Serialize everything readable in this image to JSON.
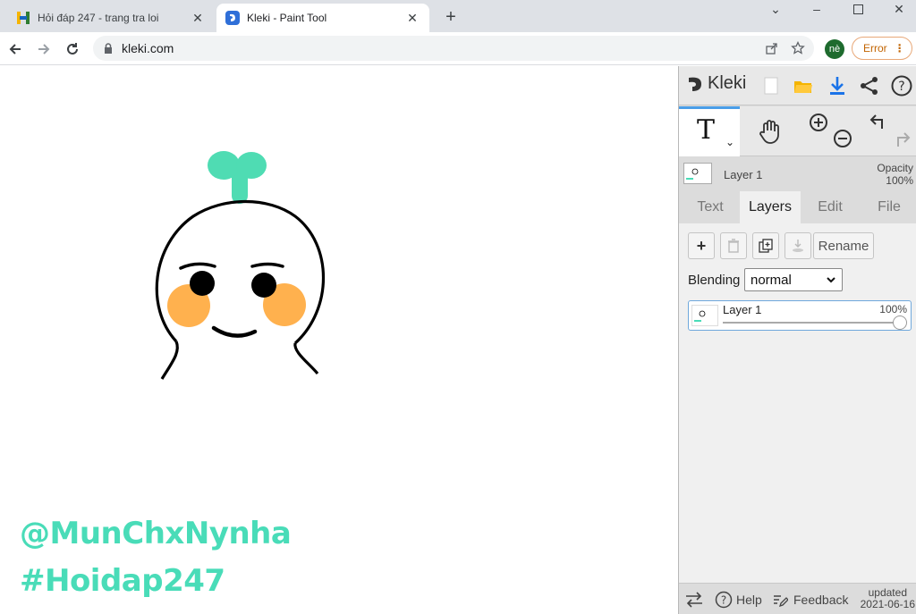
{
  "browser": {
    "tabs": [
      {
        "title": "Hỏi đáp 247 - trang tra loi",
        "active": false
      },
      {
        "title": "Kleki - Paint Tool",
        "active": true
      }
    ],
    "url": "kleki.com",
    "profile_initials": "nè",
    "error_label": "Error"
  },
  "canvas": {
    "watermark_lines": [
      "@MunChxNynha",
      "#Hoidap247"
    ],
    "colors": {
      "sprout": "#4fdcb3",
      "blush": "#ffb14e",
      "ink": "#000000",
      "watermark": "#49dcb8"
    }
  },
  "kleki": {
    "logo_text": "Kleki",
    "active_tool_glyph": "T",
    "layer_name": "Layer 1",
    "opacity_label": "Opacity",
    "opacity_value": "100%",
    "tabs": [
      "Text",
      "Layers",
      "Edit",
      "File"
    ],
    "active_tab": "Layers",
    "rename_label": "Rename",
    "blending_label": "Blending",
    "blending_value": "normal",
    "layers": [
      {
        "name": "Layer 1",
        "opacity": "100%"
      }
    ],
    "footer": {
      "help_label": "Help",
      "feedback_label": "Feedback",
      "updated_label": "updated",
      "updated_date": "2021-06-16"
    }
  }
}
